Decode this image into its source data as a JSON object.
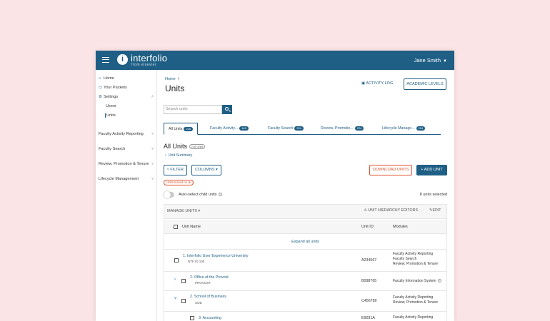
{
  "app": {
    "logo_name": "interfolio",
    "logo_sub": "from elsevier",
    "user_name": "Jane Smith"
  },
  "sidebar": {
    "items": [
      {
        "label": "Home",
        "icon": "home-icon"
      },
      {
        "label": "Your Packets",
        "icon": "packet-icon"
      },
      {
        "label": "Settings",
        "icon": "settings-icon"
      }
    ],
    "settings_sub": [
      "Users",
      "Units"
    ],
    "sections": [
      "Faculty Activity Reporting",
      "Faculty Search",
      "Review, Promotion & Tenure",
      "Lifecycle Management"
    ]
  },
  "header": {
    "breadcrumb": "Home",
    "title": "Units",
    "activity_log": "ACTIVITY LOG",
    "academic_levels": "ACADEMIC LEVELS"
  },
  "search": {
    "placeholder": "Search units"
  },
  "tabs": [
    {
      "label": "All Units",
      "count": "216"
    },
    {
      "label": "Faculty Activity...",
      "count": "145"
    },
    {
      "label": "Faculty Search",
      "count": "224"
    },
    {
      "label": "Review, Promotio...",
      "count": "224"
    },
    {
      "label": "Lifecycle Manage...",
      "count": "224"
    }
  ],
  "section": {
    "title": "All Units",
    "count_chip": "216 Units",
    "summary_link": "Unit Summary"
  },
  "actions": {
    "filter": "FILTER",
    "columns": "COLUMNS",
    "download": "DOWNLOAD UNITS",
    "add": "+ ADD UNIT",
    "filter_chip": "Units turned on"
  },
  "toggle": {
    "label": "Auto-select child units",
    "selected": "8 units selected"
  },
  "table": {
    "manage": "MANAGE UNITS",
    "hierarchy": "UNIT HIERARCHY EDITORS",
    "edit": "EDIT",
    "columns": [
      "Unit Name",
      "Unit ID",
      "Modules"
    ],
    "expand_all": "Expand all units",
    "rows": [
      {
        "name": "1. Interfolio User Experience University",
        "code": "NTF ID 100",
        "id": "A234567",
        "modules": [
          "Faculty Activity Reporting",
          "Faculty Search",
          "Review, Promotion & Tenure"
        ]
      },
      {
        "name": "2. Office of the Provost",
        "code": "PROVOST",
        "id": "B098765",
        "modules": [
          "Faculty Information System"
        ]
      },
      {
        "name": "2. School of Business",
        "code": "SOB",
        "id": "C456789",
        "modules": [
          "Faculty Activity Reporting",
          "Review, Promotion & Tenure"
        ]
      },
      {
        "name": "3. Accounting",
        "code": "",
        "id": "E9031A",
        "modules": [
          "Faculty Activity Reporting"
        ]
      }
    ]
  }
}
